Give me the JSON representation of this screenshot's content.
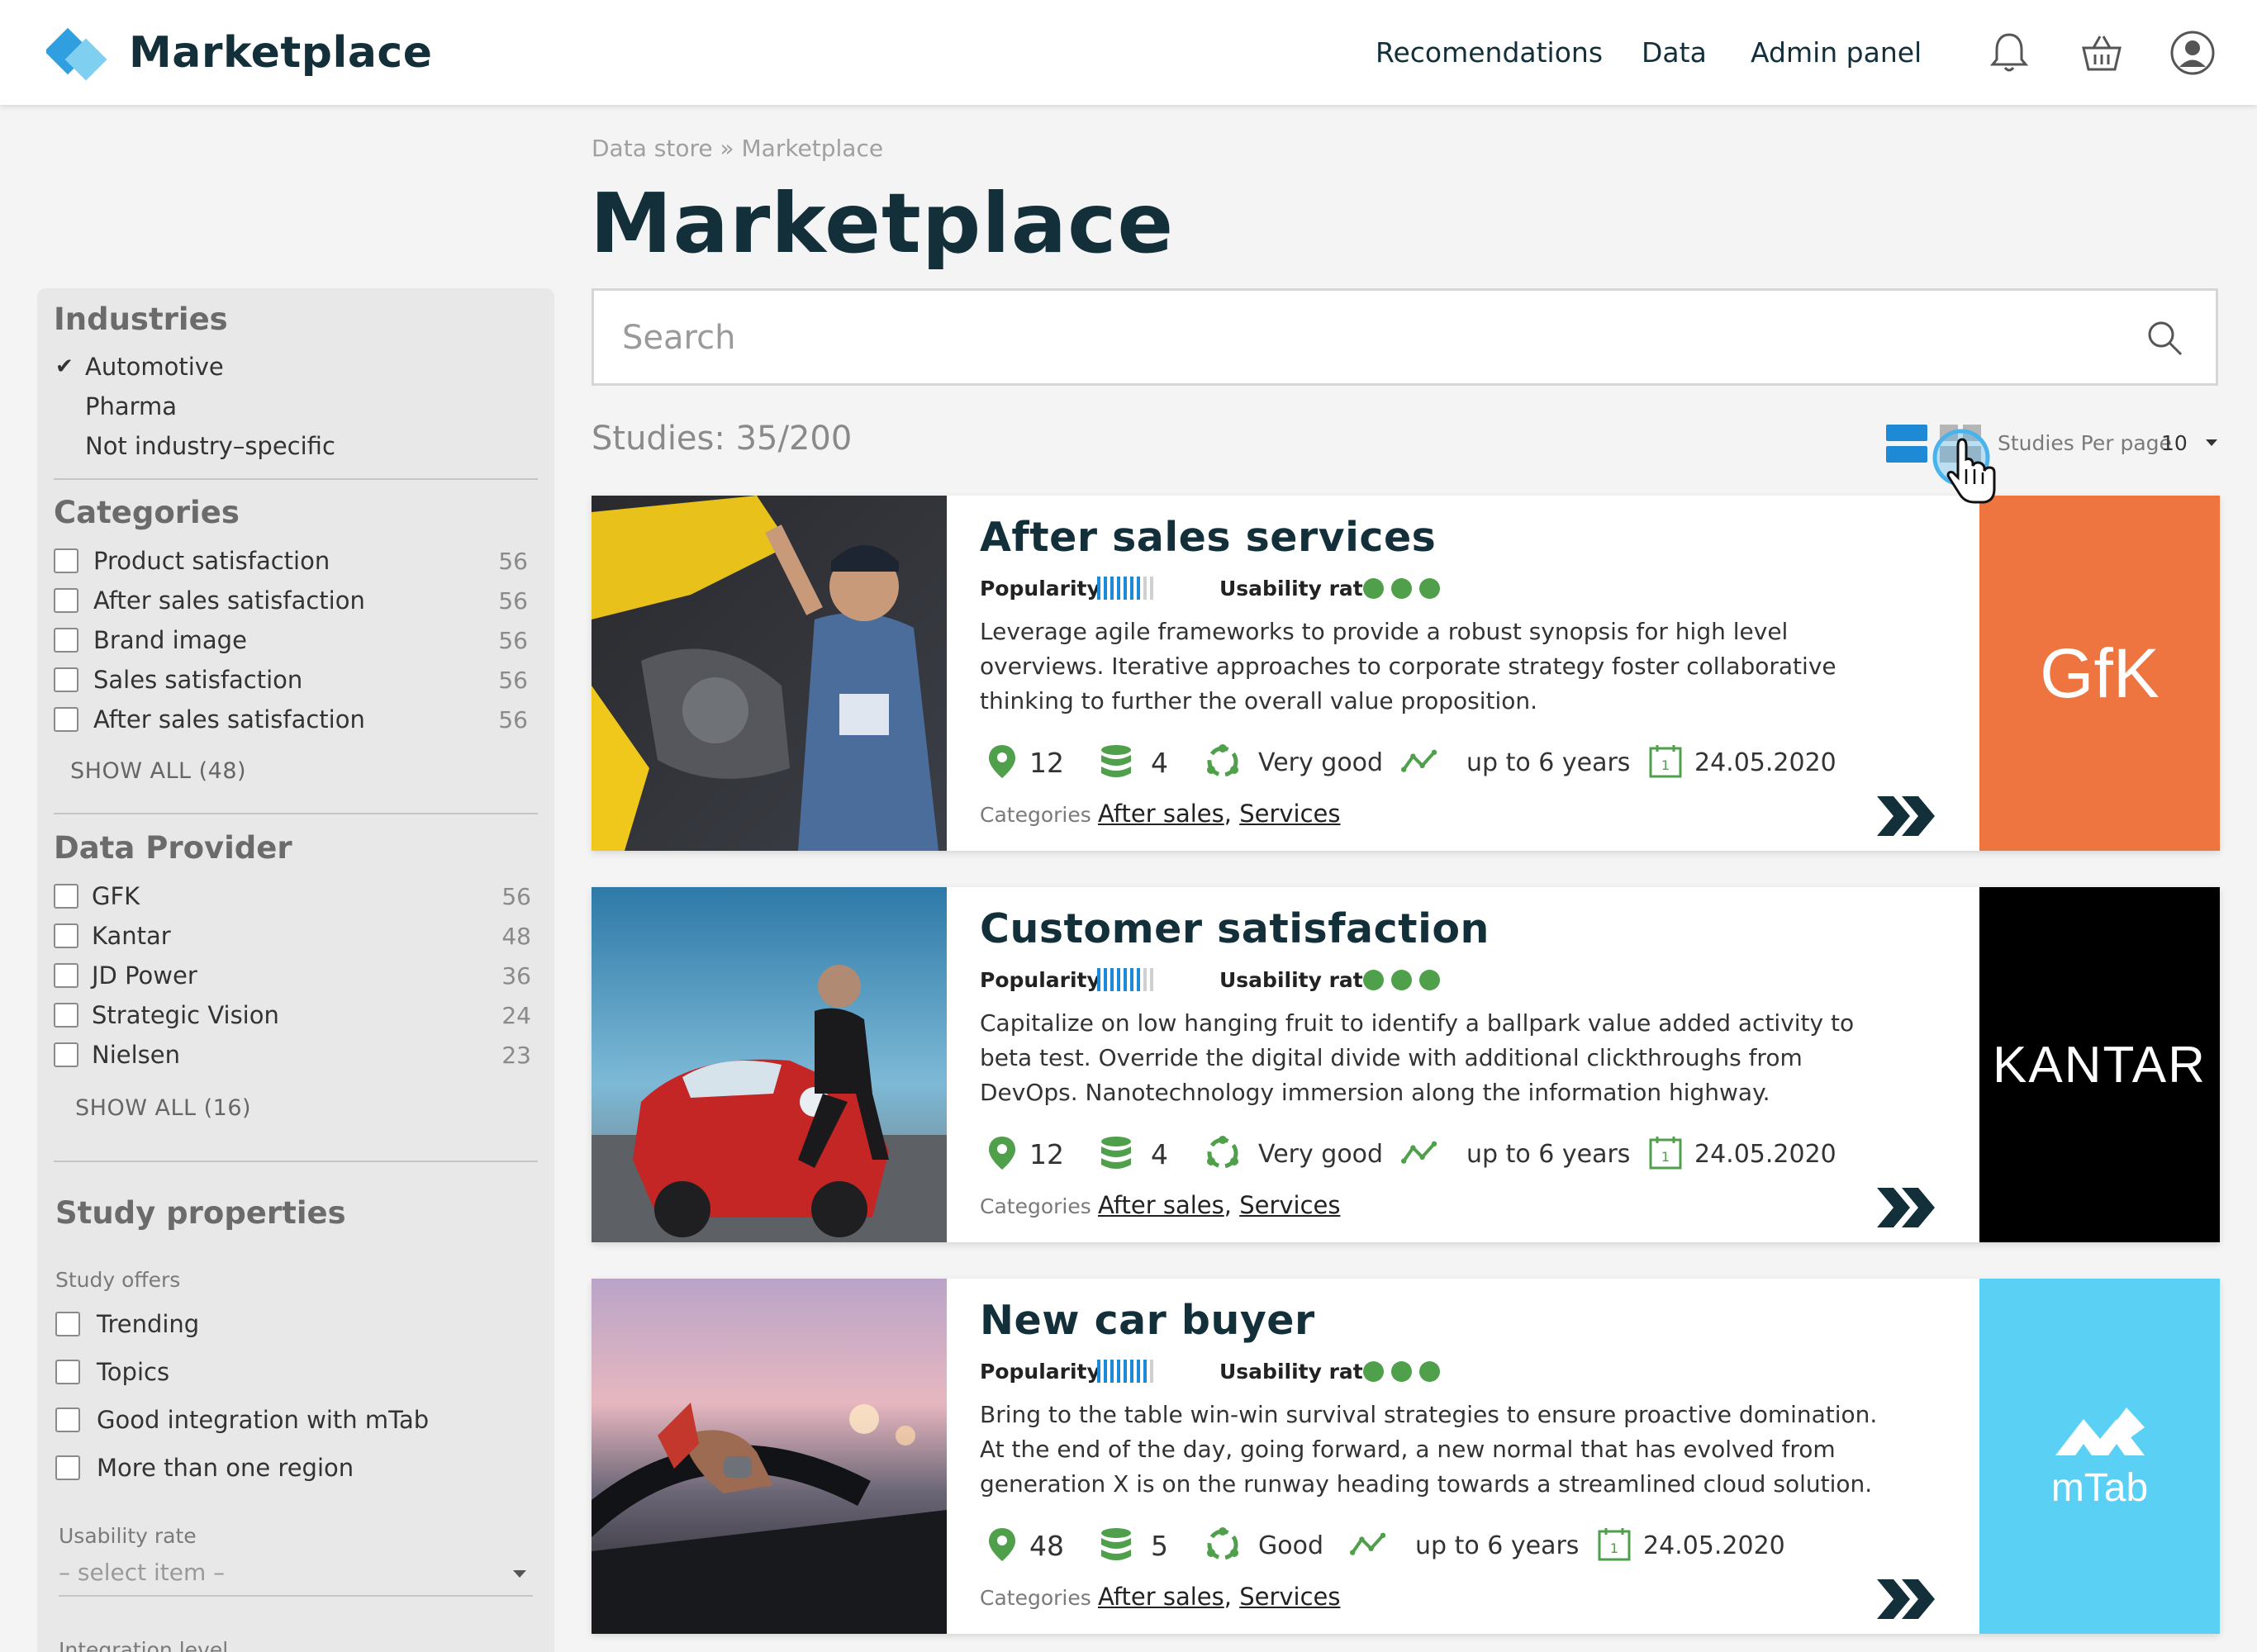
{
  "header": {
    "brand": "Marketplace",
    "nav": [
      "Recomendations",
      "Data",
      "Admin panel"
    ],
    "icons": [
      "bell-icon",
      "basket-icon",
      "user-icon"
    ]
  },
  "breadcrumb": "Data store » Marketplace",
  "page_title": "Marketplace",
  "search": {
    "placeholder": "Search",
    "value": ""
  },
  "studies_count": "Studies: 35/200",
  "per_page": {
    "label": "Studies Per page",
    "value": "10"
  },
  "sidebar": {
    "industries": {
      "title": "Industries",
      "items": [
        {
          "label": "Automotive",
          "checked": true
        },
        {
          "label": "Pharma",
          "checked": false
        },
        {
          "label": "Not industry–specific",
          "checked": false
        }
      ]
    },
    "categories": {
      "title": "Categories",
      "items": [
        {
          "label": "Product satisfaction",
          "count": "56"
        },
        {
          "label": "After sales satisfaction",
          "count": "56"
        },
        {
          "label": "Brand image",
          "count": "56"
        },
        {
          "label": "Sales satisfaction",
          "count": "56"
        },
        {
          "label": "After sales satisfaction",
          "count": "56"
        }
      ],
      "show_all": "SHOW ALL (48)"
    },
    "providers": {
      "title": "Data Provider",
      "items": [
        {
          "label": "GFK",
          "count": "56"
        },
        {
          "label": "Kantar",
          "count": "48"
        },
        {
          "label": "JD Power",
          "count": "36"
        },
        {
          "label": "Strategic Vision",
          "count": "24"
        },
        {
          "label": "Nielsen",
          "count": "23"
        }
      ],
      "show_all": "SHOW ALL (16)"
    },
    "study_properties": {
      "title": "Study properties",
      "offers_label": "Study offers",
      "offers": [
        "Trending",
        "Topics",
        "Good integration with mTab",
        "More than one region"
      ],
      "usability_label": "Usability rate",
      "usability_placeholder": "– select item –",
      "integration_label": "Integration level"
    }
  },
  "cards": [
    {
      "title": "After sales services",
      "popularity_label": "Popularity",
      "popularity_level": 7,
      "popularity_max": 9,
      "usability_label": "Usability rate",
      "usability_dots": 3,
      "description": "Leverage agile frameworks to provide a robust synopsis for high level overviews. Iterative approaches to corporate strategy foster collaborative thinking to further the overall value proposition.",
      "regions": "12",
      "datasets": "4",
      "quality": "Very good",
      "period": "up to 6 years",
      "date": "24.05.2020",
      "categories_label": "Categories",
      "categories": [
        "After sales",
        "Services"
      ],
      "provider": "GfK",
      "provider_color": "#ee7440"
    },
    {
      "title": "Customer satisfaction",
      "popularity_label": "Popularity",
      "popularity_level": 7,
      "popularity_max": 9,
      "usability_label": "Usability rate",
      "usability_dots": 3,
      "description": "Capitalize on low hanging fruit to identify a ballpark value added activity to beta test. Override the digital divide with additional clickthroughs from DevOps. Nanotechnology immersion along the information highway.",
      "regions": "12",
      "datasets": "4",
      "quality": "Very good",
      "period": "up to 6 years",
      "date": "24.05.2020",
      "categories_label": "Categories",
      "categories": [
        "After sales",
        "Services"
      ],
      "provider": "KANTAR",
      "provider_color": "#000000"
    },
    {
      "title": "New car buyer",
      "popularity_label": "Popularity",
      "popularity_level": 8,
      "popularity_max": 9,
      "usability_label": "Usability rate",
      "usability_dots": 3,
      "description": "Bring to the table win-win survival strategies to ensure proactive domination. At the end of the day, going forward, a new normal that has evolved from generation X is on the runway heading towards a streamlined cloud solution.",
      "regions": "48",
      "datasets": "5",
      "quality": "Good",
      "period": "up to 6 years",
      "date": "24.05.2020",
      "categories_label": "Categories",
      "categories": [
        "After sales",
        "Services"
      ],
      "provider": "mTab",
      "provider_color": "#5bd0f5"
    }
  ],
  "colors": {
    "accent_blue": "#1e8ad6",
    "green": "#4f9f4b",
    "dark": "#13303a"
  }
}
